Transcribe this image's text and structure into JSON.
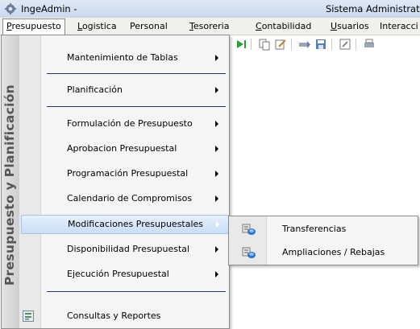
{
  "window": {
    "title": "IngeAdmin -",
    "title_right": "Sistema Administrat"
  },
  "menubar": [
    {
      "label": "Presupuesto",
      "active": true
    },
    {
      "label": "Logistica"
    },
    {
      "label": "Personal"
    },
    {
      "label": "Tesoreria"
    },
    {
      "label": "Contabilidad"
    },
    {
      "label": "Usuarios"
    },
    {
      "label": "Interacci"
    }
  ],
  "dropdown": {
    "side_label": "Presupuesto y Planificación",
    "items": [
      {
        "label": "Mantenimiento de Tablas",
        "submenu": true
      },
      {
        "label": "Planificación",
        "submenu": true
      },
      {
        "label": "Formulación de Presupuesto",
        "submenu": true
      },
      {
        "label": "Aprobacion Presupuestal",
        "submenu": true
      },
      {
        "label": "Programación Presupuestal",
        "submenu": true
      },
      {
        "label": "Calendario de Compromisos",
        "submenu": true
      },
      {
        "label": "Modificaciones Presupuestales",
        "submenu": true,
        "highlighted": true
      },
      {
        "label": "Disponibilidad Presupuestal",
        "submenu": true
      },
      {
        "label": "Ejecución Presupuestal",
        "submenu": true
      },
      {
        "label": "Consultas y Reportes",
        "icon": "report-icon"
      }
    ]
  },
  "submenu": {
    "items": [
      {
        "label": "Transferencias",
        "icon": "transfer-icon"
      },
      {
        "label": "Ampliaciones / Rebajas",
        "icon": "transfer-icon"
      }
    ]
  },
  "colors": {
    "highlight": "#c9ddf5",
    "separator": "#1e3a6e",
    "side_text": "#555555"
  }
}
